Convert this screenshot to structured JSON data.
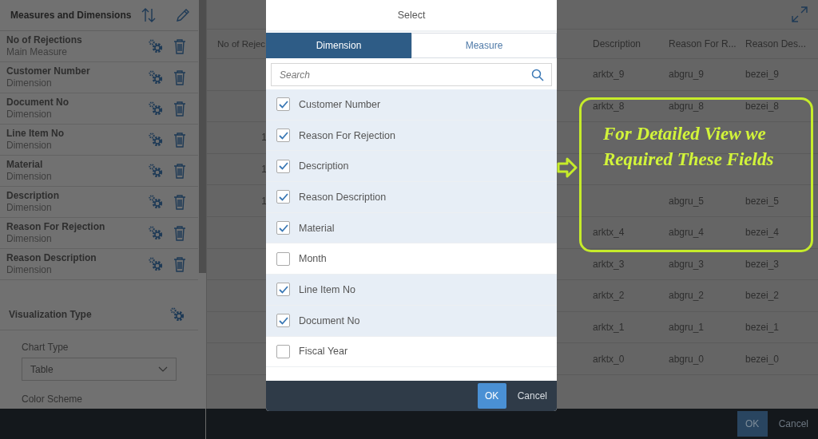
{
  "sidebar": {
    "title": "Measures and Dimensions",
    "items": [
      {
        "name": "No of Rejections",
        "type": "Main Measure"
      },
      {
        "name": "Customer Number",
        "type": "Dimension"
      },
      {
        "name": "Document No",
        "type": "Dimension"
      },
      {
        "name": "Line Item No",
        "type": "Dimension"
      },
      {
        "name": "Material",
        "type": "Dimension"
      },
      {
        "name": "Description",
        "type": "Dimension"
      },
      {
        "name": "Reason For Rejection",
        "type": "Dimension"
      },
      {
        "name": "Reason Description",
        "type": "Dimension"
      }
    ],
    "visualization": {
      "title": "Visualization Type",
      "chart_type_label": "Chart Type",
      "chart_type_value": "Table",
      "color_scheme_label": "Color Scheme"
    }
  },
  "table": {
    "columns": [
      "No of Rejec",
      "Description",
      "Reason For R...",
      "Reason Des..."
    ],
    "rows": [
      [
        null,
        "arktx_9",
        "abgru_9",
        "bezei_9"
      ],
      [
        null,
        "arktx_8",
        "abgru_8",
        "bezei_8"
      ],
      [
        "1",
        null,
        null,
        null
      ],
      [
        "1",
        null,
        null,
        null
      ],
      [
        "1",
        null,
        "abgru_5",
        "bezei_5"
      ],
      [
        null,
        "arktx_4",
        "abgru_4",
        "bezei_4"
      ],
      [
        null,
        "arktx_3",
        "abgru_3",
        "bezei_3"
      ],
      [
        null,
        "arktx_2",
        "abgru_2",
        "bezei_2"
      ],
      [
        null,
        "arktx_1",
        "abgru_1",
        "bezei_1"
      ],
      [
        null,
        "arktx_0",
        "abgru_0",
        "bezei_0"
      ]
    ]
  },
  "footer_buttons": [
    {
      "label": "OK",
      "kind": "primary"
    },
    {
      "label": "Cancel",
      "kind": "text"
    }
  ],
  "dialog": {
    "title": "Select",
    "tabs": [
      {
        "label": "Dimension",
        "selected": true
      },
      {
        "label": "Measure",
        "selected": false
      }
    ],
    "search": {
      "placeholder": "Search"
    },
    "options": [
      {
        "label": "Customer Number",
        "checked": true
      },
      {
        "label": "Reason For Rejection",
        "checked": true
      },
      {
        "label": "Description",
        "checked": true
      },
      {
        "label": "Reason Description",
        "checked": true
      },
      {
        "label": "Material",
        "checked": true
      },
      {
        "label": "Month",
        "checked": false
      },
      {
        "label": "Line Item No",
        "checked": true
      },
      {
        "label": "Document No",
        "checked": true
      },
      {
        "label": "Fiscal Year",
        "checked": false
      }
    ],
    "buttons": [
      {
        "label": "OK",
        "kind": "primary"
      },
      {
        "label": "Cancel",
        "kind": "text"
      }
    ]
  },
  "annotation": {
    "text": "For Detailed View we Required These Fields"
  }
}
